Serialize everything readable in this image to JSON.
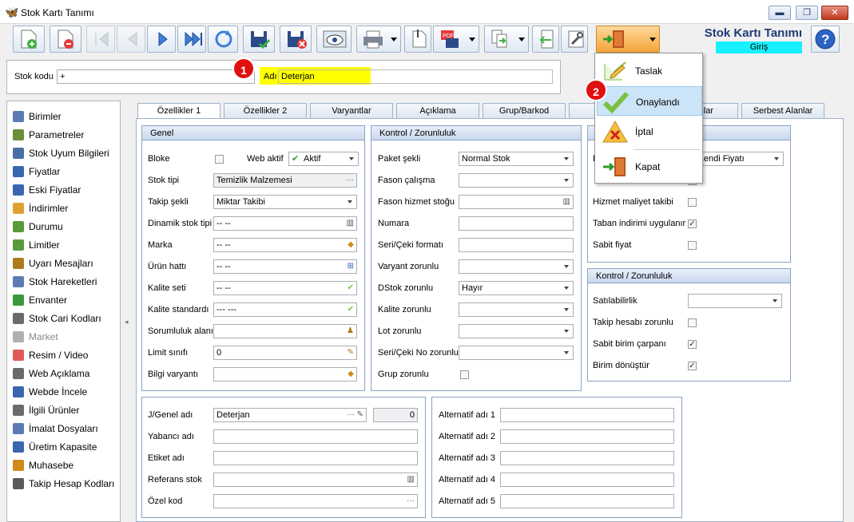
{
  "window": {
    "title": "Stok Kartı Tanımı",
    "min": "▬",
    "max": "❐",
    "close": "✕"
  },
  "header": {
    "form_title": "Stok Kartı Tanımı",
    "mode": "Giriş"
  },
  "code": {
    "stok_kodu_label": "Stok kodu",
    "stok_kodu_value": "+",
    "adi_label": "Adı",
    "adi_value": "Deterjan"
  },
  "badges": [
    "1",
    "2"
  ],
  "sidebar": [
    "Birimler",
    "Parametreler",
    "Stok Uyum Bilgileri",
    "Fiyatlar",
    "Eski Fiyatlar",
    "İndirimler",
    "Durumu",
    "Limitler",
    "Uyarı Mesajları",
    "Stok Hareketleri",
    "Envanter",
    "Stok Cari Kodları",
    "Market",
    "Resim / Video",
    "Web Açıklama",
    "Webde İncele",
    "İlgili Ürünler",
    "İmalat Dosyaları",
    "Üretim Kapasite",
    "Muhasebe",
    "Takip Hesap Kodları"
  ],
  "tabs": [
    "Özellikler 1",
    "Özellikler 2",
    "Varyantlar",
    "Açıklama",
    "Grup/Barkod",
    "lar",
    "Serbest Alanlar"
  ],
  "genel": {
    "title": "Genel",
    "bloke": "Bloke",
    "web_aktif": "Web aktif",
    "web_aktif_value": "Aktif",
    "stok_tipi": "Stok tipi",
    "stok_tipi_value": "Temizlik Malzemesi",
    "takip_sekli": "Takip şekli",
    "takip_sekli_value": "Miktar Takibi",
    "dinamik": "Dinamik stok tipi",
    "dinamik_value": "-- --",
    "marka": "Marka",
    "marka_value": "-- --",
    "urun_hatti": "Ürün hattı",
    "urun_hatti_value": "-- --",
    "kalite_seti": "Kalite seti",
    "kalite_seti_value": "-- --",
    "kalite_std": "Kalite standardı",
    "kalite_std_value": "--- ---",
    "sorumluluk": "Sorumluluk alanı",
    "limit": "Limit sınıfı",
    "limit_value": "0",
    "bilgi": "Bilgi varyantı"
  },
  "kontrol": {
    "title": "Kontrol / Zorunluluk",
    "paket": "Paket şekli",
    "paket_value": "Normal Stok",
    "fason": "Fason çalışma",
    "fason_hizmet": "Fason hizmet stoğu",
    "numara": "Numara",
    "seri_format": "Seri/Çeki formatı",
    "varyant": "Varyant zorunlu",
    "dstok": "DStok zorunlu",
    "dstok_value": "Hayır",
    "kalite": "Kalite zorunlu",
    "lot": "Lot zorunlu",
    "seri_no": "Seri/Çeki No zorunlu",
    "grup": "Grup zorunlu"
  },
  "right1": {
    "kendi_fiyati": "k Kendi Fiyatı",
    "hizmet": "Hizmet maliyet takibi",
    "taban": "Taban indirimi uygulanır",
    "sabit": "Sabit fiyat"
  },
  "kontrol2": {
    "title": "Kontrol / Zorunluluk",
    "satilabilirlik": "Satılabilirlik",
    "takip_hesabi": "Takip hesabı zorunlu",
    "sabit_birim": "Sabit birim çarpanı",
    "birim_donustur": "Birim dönüştür"
  },
  "names": {
    "jgenel": "J/Genel adı",
    "jgenel_value": "Deterjan",
    "jgenel_count": "0",
    "yabanci": "Yabancı adı",
    "etiket": "Etiket adı",
    "referans": "Referans stok",
    "ozel": "Özel kod"
  },
  "alternatif": [
    "Alternatif adı 1",
    "Alternatif adı 2",
    "Alternatif adı 3",
    "Alternatif adı 4",
    "Alternatif adı 5"
  ],
  "menu": {
    "taslak": "Taslak",
    "onaylandi": "Onaylandı",
    "iptal": "İptal",
    "kapat": "Kapat"
  },
  "colors": {
    "accent": "#1f3b77",
    "highlight": "#ffff00",
    "mode_bg": "#17f0ff",
    "badge": "#e01010",
    "menu_hover": "#cce4f7"
  }
}
